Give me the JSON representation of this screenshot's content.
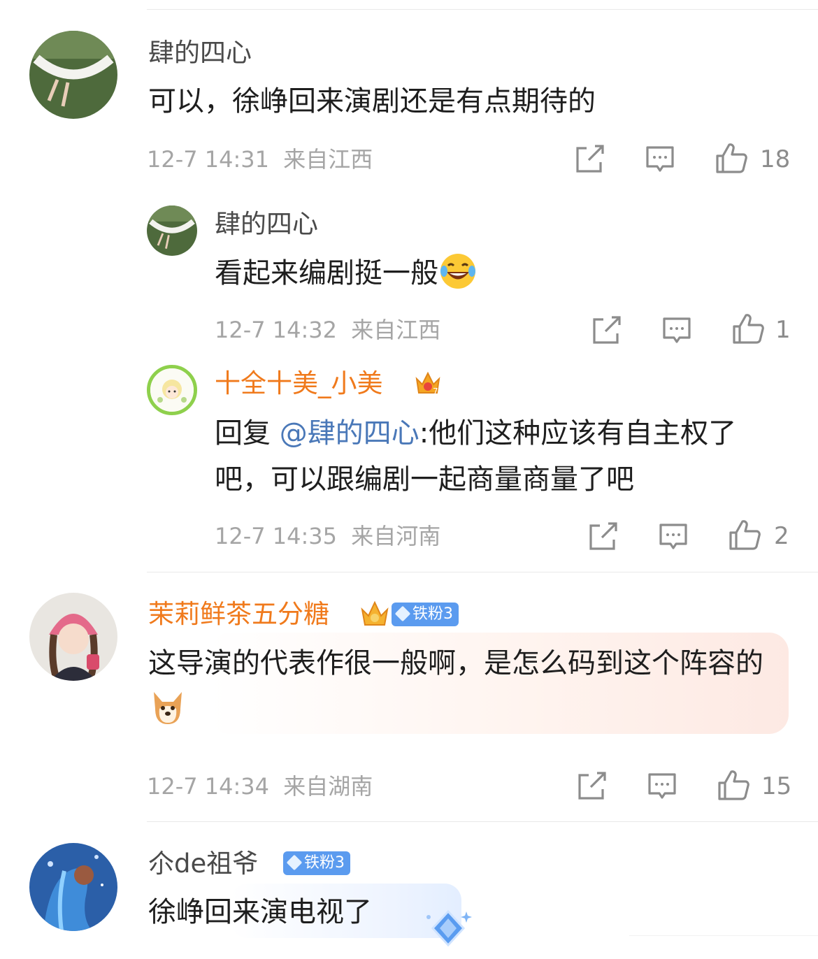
{
  "comments": [
    {
      "username": "肆的四心",
      "text": "可以，徐峥回来演剧还是有点期待的",
      "time": "12-7 14:31",
      "location": "来自江西",
      "likes": "18",
      "replies": [
        {
          "username": "肆的四心",
          "text": "看起来编剧挺一般",
          "emoji": "laughing-tears-emoji",
          "time": "12-7 14:32",
          "location": "来自江西",
          "likes": "1"
        },
        {
          "username": "十全十美_小美",
          "reply_prefix": "回复 ",
          "mention": "@肆的四心",
          "text": ":他们这种应该有自主权了吧，可以跟编剧一起商量商量了吧",
          "time": "12-7 14:35",
          "location": "来自河南",
          "likes": "2"
        }
      ]
    },
    {
      "username": "茉莉鲜茶五分糖",
      "badge": "铁粉3",
      "text": "这导演的代表作很一般啊，是怎么码到这个阵容的",
      "emoji": "dog-emoji",
      "time": "12-7 14:34",
      "location": "来自湖南",
      "likes": "15"
    },
    {
      "username": "尒de祖爷",
      "badge": "铁粉3",
      "text": "徐峥回来演电视了"
    }
  ],
  "colors": {
    "username_vip": "#f07a1c",
    "mention": "#4a78b8",
    "badge": "#5b9bef",
    "meta": "#a5a5a5"
  },
  "icons": [
    "share-icon",
    "comment-icon",
    "like-icon",
    "crown-icon",
    "diamond-icon"
  ]
}
